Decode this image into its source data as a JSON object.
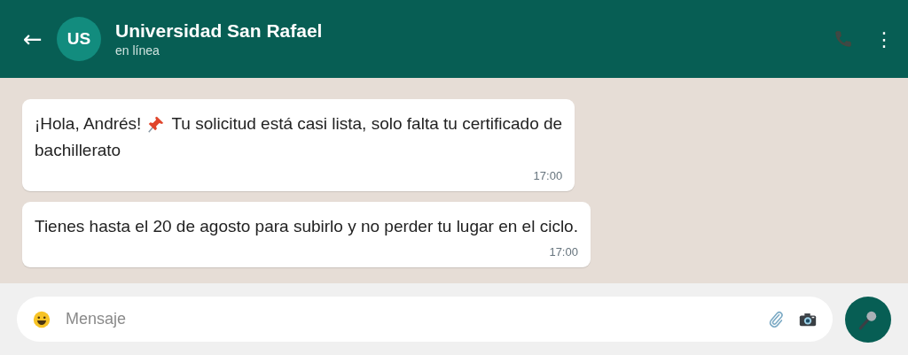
{
  "header": {
    "back": "←",
    "avatar_initials": "US",
    "title": "Universidad San Rafael",
    "status": "en línea",
    "menu": "⋮"
  },
  "messages": [
    {
      "lines": [
        [
          {
            "kind": "text",
            "text": "¡Hola, Andrés!"
          },
          {
            "kind": "pin"
          },
          {
            "kind": "text",
            "text": "Tu solicitud está casi lista, solo falta tu certificado de"
          }
        ],
        [
          {
            "kind": "text",
            "text": "bachillerato"
          }
        ]
      ],
      "time": "17:00"
    },
    {
      "lines": [
        [
          {
            "kind": "text",
            "text": "Tienes hasta el 20 de agosto para subirlo y no perder tu lugar en el ciclo."
          }
        ]
      ],
      "time": "17:00"
    }
  ],
  "composer": {
    "placeholder": "Mensaje"
  }
}
